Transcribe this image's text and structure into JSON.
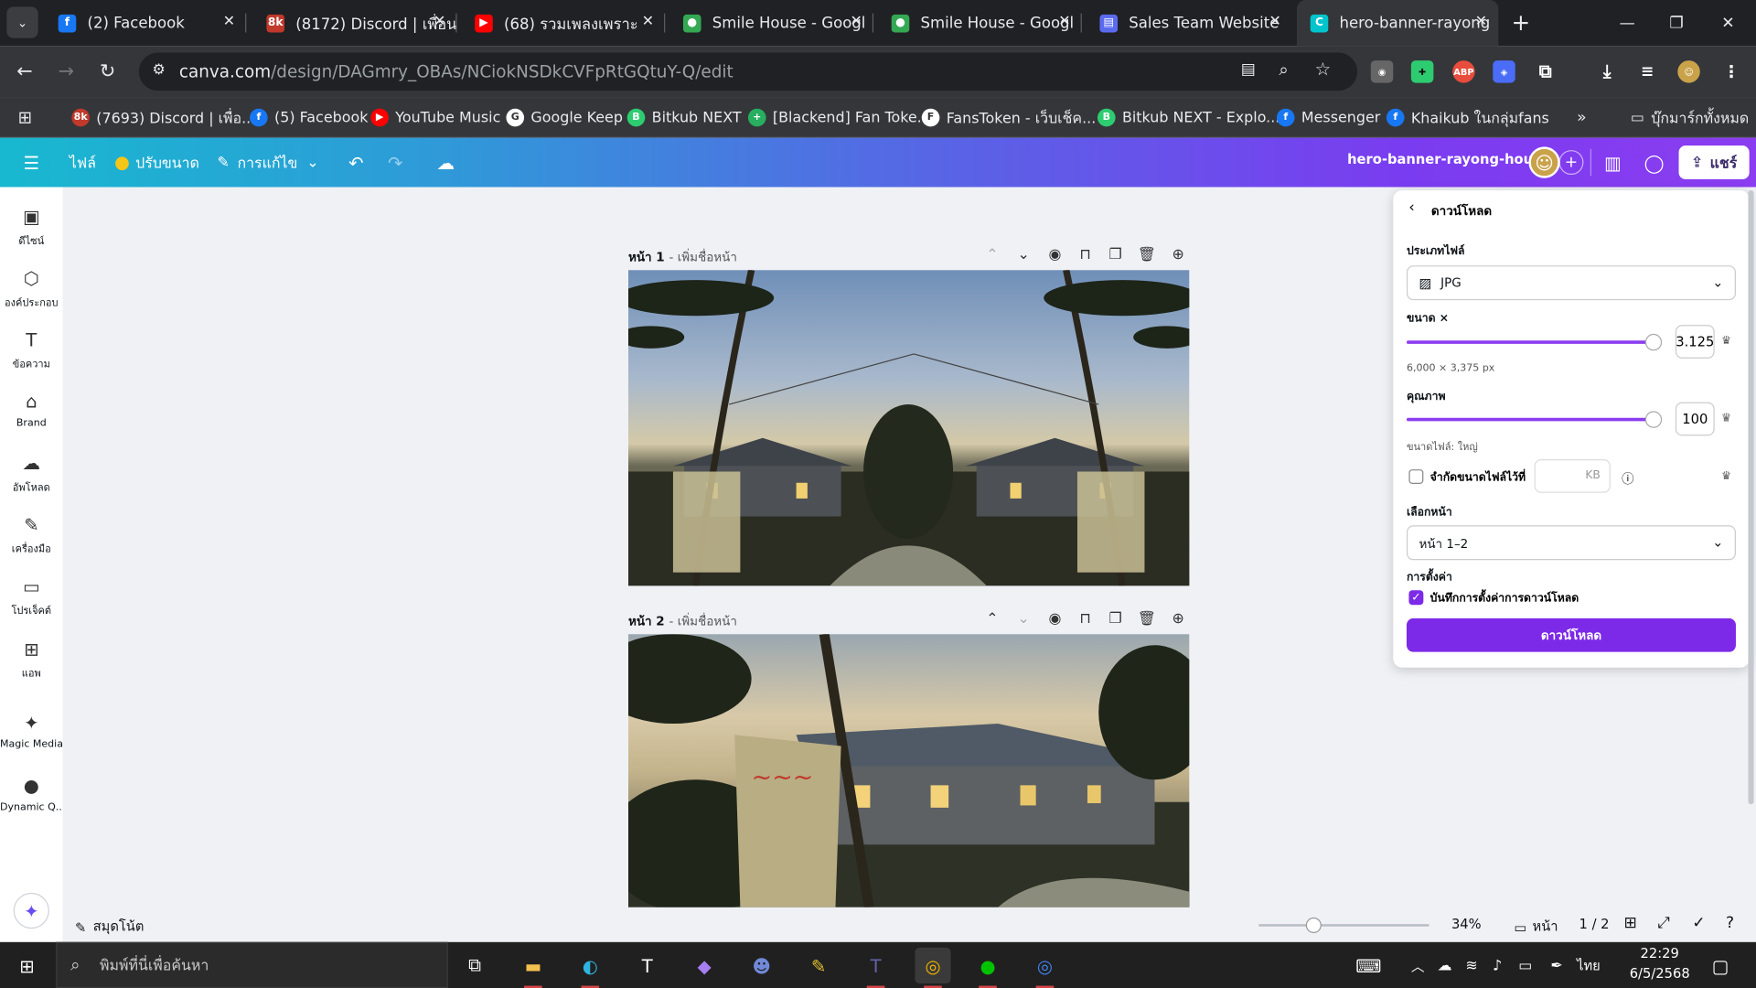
{
  "browser": {
    "tabs": [
      {
        "title": "(2) Facebook",
        "icon": "facebook-icon",
        "color": "#1877f2",
        "glyph": "f"
      },
      {
        "title": "(8172) Discord | เพื่อน",
        "icon": "discord-icon",
        "color": "#c0392b",
        "glyph": "8k"
      },
      {
        "title": "(68) รวมเพลงเพราะ",
        "icon": "youtube-icon",
        "color": "#ff0000",
        "glyph": "▶"
      },
      {
        "title": "Smile House - Googl",
        "icon": "maps-pin-icon",
        "color": "#34a853",
        "glyph": "●"
      },
      {
        "title": "Smile House - Googl",
        "icon": "maps-pin-icon",
        "color": "#34a853",
        "glyph": "●"
      },
      {
        "title": "Sales Team Website",
        "icon": "sites-icon",
        "color": "#5b6bf0",
        "glyph": "▤"
      },
      {
        "title": "hero-banner-rayong",
        "icon": "canva-icon",
        "color": "#00c4cc",
        "glyph": "C"
      }
    ],
    "url_domain": "canva.com",
    "url_path": "/design/DAGmry_OBAs/NCiokNSDkCVFpRtGQtuY-Q/edit",
    "bookmarks": [
      {
        "label": "(7693) Discord | เพื่อ...",
        "color": "#c0392b",
        "glyph": "8k"
      },
      {
        "label": "(5) Facebook",
        "color": "#1877f2",
        "glyph": "f"
      },
      {
        "label": "YouTube Music",
        "color": "#ff0000",
        "glyph": "▶"
      },
      {
        "label": "Google Keep",
        "color": "#ffffff",
        "glyph": "G"
      },
      {
        "label": "Bitkub NEXT",
        "color": "#2ecc71",
        "glyph": "B"
      },
      {
        "label": "[Blackend] Fan Toke...",
        "color": "#27ae60",
        "glyph": "+"
      },
      {
        "label": "FansToken - เว็บเช็ค...",
        "color": "#ffffff",
        "glyph": "F"
      },
      {
        "label": "Bitkub NEXT - Explo...",
        "color": "#2ecc71",
        "glyph": "B"
      },
      {
        "label": "Messenger",
        "color": "#1877f2",
        "glyph": "f"
      },
      {
        "label": "Khaikub ในกลุ่มfans",
        "color": "#1877f2",
        "glyph": "f"
      }
    ],
    "bookmarks_folder": "บุ๊กมาร์กทั้งหมด"
  },
  "canva": {
    "menu": {
      "file": "ไฟล์",
      "resize": "ปรับขนาด",
      "edit": "การแก้ไข"
    },
    "design_title": "hero-banner-rayong-house",
    "share_label": "แชร์"
  },
  "rail": [
    {
      "label": "ดีไซน์",
      "icon": "design-icon",
      "glyph": "▣"
    },
    {
      "label": "องค์ประกอบ",
      "icon": "elements-icon",
      "glyph": "⬡"
    },
    {
      "label": "ข้อความ",
      "icon": "text-icon",
      "glyph": "T"
    },
    {
      "label": "Brand",
      "icon": "brand-icon",
      "glyph": "⌂"
    },
    {
      "label": "อัพโหลด",
      "icon": "upload-icon",
      "glyph": "☁"
    },
    {
      "label": "เครื่องมือ",
      "icon": "draw-icon",
      "glyph": "✎"
    },
    {
      "label": "โปรเจ็คต์",
      "icon": "folder-icon",
      "glyph": "▭"
    },
    {
      "label": "แอพ",
      "icon": "apps-icon",
      "glyph": "⊞"
    },
    {
      "label": "Magic Media",
      "icon": "magic-media-icon",
      "glyph": "✦"
    },
    {
      "label": "Dynamic Q...",
      "icon": "qr-icon",
      "glyph": "●"
    }
  ],
  "pages": [
    {
      "title": "หน้า 1",
      "name_placeholder": "- เพิ่มชื่อหน้า"
    },
    {
      "title": "หน้า 2",
      "name_placeholder": "- เพิ่มชื่อหน้า"
    }
  ],
  "download": {
    "header": "ดาวน์โหลด",
    "file_type_label": "ประเภทไฟล์",
    "file_type": "JPG",
    "size_label": "ขนาด ×",
    "size_value": "3.125",
    "size_fraction": 1.0,
    "dimensions": "6,000 × 3,375 px",
    "quality_label": "คุณภาพ",
    "quality_value": "100",
    "quality_fraction": 1.0,
    "file_size_note": "ขนาดไฟล์: ใหญ่",
    "limit_label": "จำกัดขนาดไฟล์ไว้ที่",
    "limit_unit": "KB",
    "select_pages_label": "เลือกหน้า",
    "select_pages_value": "หน้า 1–2",
    "settings_label": "การตั้งค่า",
    "save_settings_label": "บันทึกการตั้งค่าการดาวน์โหลด",
    "save_settings_checked": true,
    "button_label": "ดาวน์โหลด",
    "accent": "#7d2ae8"
  },
  "footer": {
    "notes_label": "สมุดโน้ต",
    "zoom": "34%",
    "pages_label": "หน้า",
    "page_count": "1 / 2"
  },
  "taskbar": {
    "search_placeholder": "พิมพ์ที่นี่เพื่อค้นหา",
    "lang": "ไทย",
    "time": "22:29",
    "date": "6/5/2568"
  }
}
